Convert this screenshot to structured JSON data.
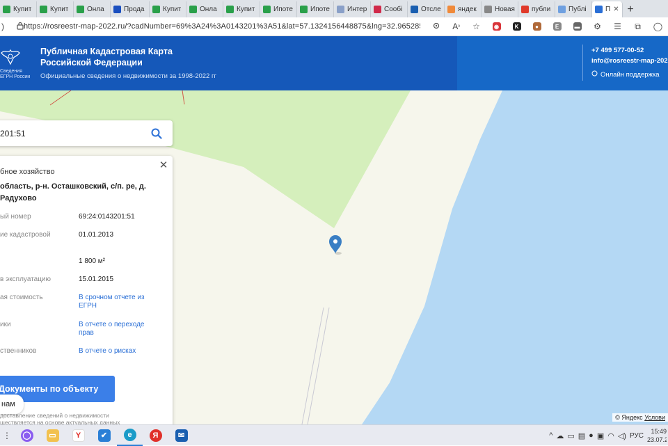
{
  "browser": {
    "tabs": [
      {
        "label": "Купит",
        "icon": "tab-site-icon",
        "color": "#2aa04a"
      },
      {
        "label": "Купит",
        "icon": "tab-site-icon",
        "color": "#2aa04a"
      },
      {
        "label": "Онла",
        "icon": "tab-site-icon",
        "color": "#2aa04a"
      },
      {
        "label": "Прода",
        "icon": "tab-site-icon",
        "color": "#1a4fbf"
      },
      {
        "label": "Купит",
        "icon": "tab-site-icon",
        "color": "#2aa04a"
      },
      {
        "label": "Онла",
        "icon": "tab-site-icon",
        "color": "#2aa04a"
      },
      {
        "label": "Купит",
        "icon": "tab-site-icon",
        "color": "#2aa04a"
      },
      {
        "label": "Ипоте",
        "icon": "tab-site-icon",
        "color": "#2aa04a"
      },
      {
        "label": "Ипоте",
        "icon": "tab-site-icon",
        "color": "#2aa04a"
      },
      {
        "label": "Интер",
        "icon": "tab-site-icon",
        "color": "#8aa0c8"
      },
      {
        "label": "Сообі",
        "icon": "tab-site-icon",
        "color": "#d02a4a"
      },
      {
        "label": "Отсле",
        "icon": "tab-site-icon",
        "color": "#1a5fb0"
      },
      {
        "label": "яндек",
        "icon": "tab-site-icon",
        "color": "#f08a3a"
      },
      {
        "label": "Новая",
        "icon": "tab-site-icon",
        "color": "#888888"
      },
      {
        "label": "публи",
        "icon": "tab-site-icon",
        "color": "#e03a2a"
      },
      {
        "label": "Публі",
        "icon": "tab-site-icon",
        "color": "#6fa0e0"
      },
      {
        "label": "П",
        "icon": "tab-site-icon",
        "color": "#2a6fd6",
        "active": true
      }
    ],
    "new_tab": "+",
    "url": "https://rosreestr-map-2022.ru/?cadNumber=69%3A24%3A0143201%3A51&lat=57.1324156448875&lng=32.96528579581..."
  },
  "header": {
    "emblem_text_1": "Сведения",
    "emblem_text_2": "ЕГРН России",
    "title": "Публичная Кадастровая Карта Российской Федерации",
    "subtitle": "Официальные сведения о недвижимости за 1998-2022 гг",
    "phone": "+7 499 577-00-52",
    "email": "info@rosreestr-map-2022",
    "support": "Онлайн поддержка"
  },
  "search": {
    "value": "201:51"
  },
  "panel": {
    "category": "бное хозяйство",
    "address": "область, р-н. Осташковский, с/п. ре, д. Радухово",
    "rows": [
      {
        "label": "ый номер",
        "value": "69:24:0143201:51"
      },
      {
        "label": "ие кадастровой",
        "value": "01.01.2013"
      },
      {
        "label": "",
        "value": "1 800 м²"
      },
      {
        "label": "в эксплуатацию",
        "value": "15.01.2015"
      },
      {
        "label": "ая стоимость",
        "value": "В срочном отчете из ЕГРН",
        "link": true
      },
      {
        "label": "ики",
        "value": "В отчете о переходе прав",
        "link": true
      },
      {
        "label": "ственников",
        "value": "В отчете о рисках",
        "link": true
      }
    ],
    "docs_button": "Документы по объекту",
    "foot_note_1": "доставление сведений о недвижимости",
    "foot_note_2": "ществляется на основе актуальных данных"
  },
  "chat_chip": "нам",
  "map": {
    "attribution_prefix": "© Яндекс",
    "attribution_link": "Услови",
    "colors": {
      "green": "#d5efbc",
      "land": "#f6f6ec",
      "water": "#b4d8f4",
      "marker": "#3a7fc4"
    }
  },
  "taskbar": {
    "lang": "РУС",
    "time": "15:49",
    "date": "23.07.20"
  }
}
